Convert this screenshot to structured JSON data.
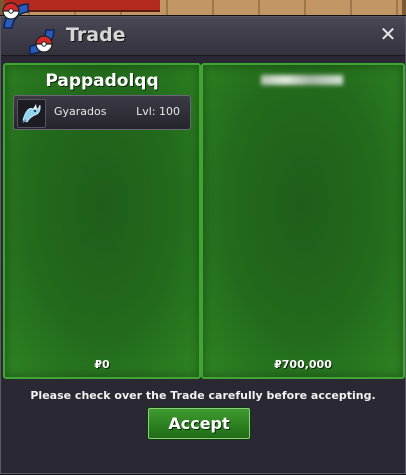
{
  "window": {
    "title": "Trade",
    "close_label": "✕"
  },
  "left_panel": {
    "player_name": "Pappadolqq",
    "offer": [
      {
        "pokemon": "Gyarados",
        "level": "Lvl: 100",
        "icon": "gyarados-icon"
      }
    ],
    "money": "₽0"
  },
  "right_panel": {
    "player_name_redacted": true,
    "money": "₽700,000"
  },
  "notice": "Please check over the Trade carefully before accepting.",
  "accept_label": "Accept",
  "colors": {
    "panel_green": "#236b1c",
    "panel_border": "#3fa631",
    "window_bg": "#2a2833",
    "button_green": "#2f8424"
  }
}
